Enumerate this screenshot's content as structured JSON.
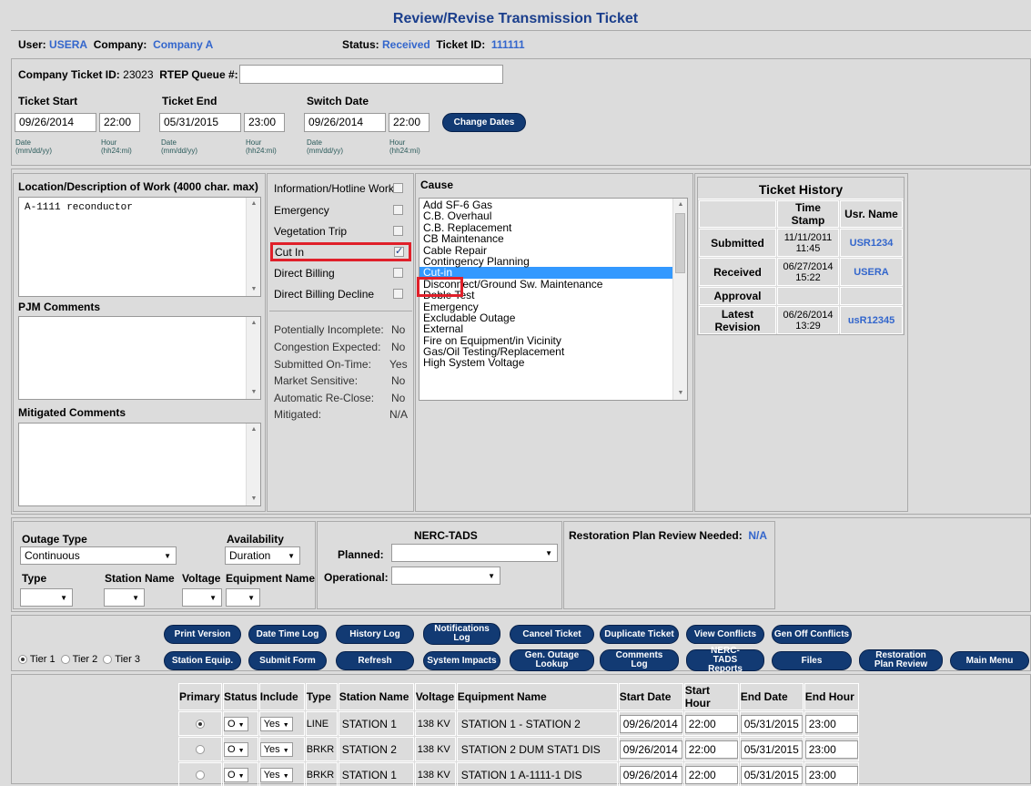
{
  "header": {
    "title": "Review/Revise Transmission Ticket"
  },
  "userbar": {
    "user_label": "User:",
    "user": "USERA",
    "company_label": "Company:",
    "company": "Company A",
    "status_label": "Status:",
    "status": "Received",
    "ticket_label": "Ticket ID:",
    "ticket_id": "111111"
  },
  "ticket": {
    "company_ticket_label": "Company Ticket ID:",
    "company_ticket_id": "23023",
    "rtep_label": "RTEP Queue #:",
    "rtep_value": ""
  },
  "dates": {
    "start_label": "Ticket Start",
    "end_label": "Ticket End",
    "switch_label": "Switch Date",
    "start_date": "09/26/2014",
    "start_hour": "22:00",
    "end_date": "05/31/2015",
    "end_hour": "23:00",
    "switch_date": "09/26/2014",
    "switch_hour": "22:00",
    "change_button": "Change Dates",
    "hint_date": "Date",
    "hint_date_fmt": "(mm/dd/yy)",
    "hint_hour": "Hour",
    "hint_hour_fmt": "(hh24:mi)"
  },
  "location": {
    "label": "Location/Description of Work (4000 char. max)",
    "value": "A-1111  reconductor"
  },
  "pjm": {
    "label": "PJM Comments"
  },
  "mitigated": {
    "label": "Mitigated Comments"
  },
  "flags": [
    {
      "label": "Information/Hotline Work",
      "checked": false
    },
    {
      "label": "Emergency",
      "checked": false
    },
    {
      "label": "Vegetation Trip",
      "checked": false
    },
    {
      "label": "Cut In",
      "checked": true
    },
    {
      "label": "Direct Billing",
      "checked": false
    },
    {
      "label": "Direct Billing Decline",
      "checked": false
    }
  ],
  "status_rows": [
    {
      "label": "Potentially Incomplete:",
      "value": "No"
    },
    {
      "label": "Congestion Expected:",
      "value": "No"
    },
    {
      "label": "Submitted On-Time:",
      "value": "Yes"
    },
    {
      "label": "Market Sensitive:",
      "value": "No"
    },
    {
      "label": "Automatic Re-Close:",
      "value": "No"
    },
    {
      "label": "Mitigated:",
      "value": "N/A"
    }
  ],
  "cause": {
    "label": "Cause",
    "selected": "Cut-in",
    "items": [
      "Add SF-6 Gas",
      "C.B. Overhaul",
      "C.B. Replacement",
      "CB Maintenance",
      "Cable Repair",
      "Contingency Planning",
      "Cut-in",
      "Disconnect/Ground Sw. Maintenance",
      "Doble Test",
      "Emergency",
      "Excludable Outage",
      "External",
      "Fire on Equipment/in Vicinity",
      "Gas/Oil Testing/Replacement",
      "High System Voltage"
    ]
  },
  "history": {
    "title": "Ticket History",
    "col_time": "Time Stamp",
    "col_user": "Usr. Name",
    "rows": [
      {
        "label": "Submitted",
        "date": "11/11/2011",
        "time": "11:45",
        "user": "USR1234"
      },
      {
        "label": "Received",
        "date": "06/27/2014",
        "time": "15:22",
        "user": "USERA"
      },
      {
        "label": "Approval",
        "date": "",
        "time": "",
        "user": ""
      },
      {
        "label": "Latest Revision",
        "date": "06/26/2014",
        "time": "13:29",
        "user": "usR12345"
      }
    ]
  },
  "outage": {
    "type_label": "Outage Type",
    "type_value": "Continuous",
    "availability_label": "Availability",
    "availability_value": "Duration",
    "type2_label": "Type",
    "station_label": "Station Name",
    "voltage_label": "Voltage",
    "equipment_label": "Equipment Name"
  },
  "nerc": {
    "title": "NERC-TADS",
    "planned_label": "Planned:",
    "operational_label": "Operational:"
  },
  "restoration": {
    "label": "Restoration Plan Review Needed:",
    "value": "N/A"
  },
  "buttons": {
    "print": "Print Version",
    "datetime": "Date Time Log",
    "history": "History Log",
    "notifications": "Notifications Log",
    "cancel": "Cancel Ticket",
    "duplicate": "Duplicate Ticket",
    "conflicts": "View Conflicts",
    "genoff": "Gen Off Conflicts",
    "station_equip": "Station Equip.",
    "submit": "Submit Form",
    "refresh": "Refresh",
    "impacts": "System Impacts",
    "genoutage": "Gen. Outage Lookup",
    "comments": "Comments Log",
    "nerc_reports": "NERC-TADS Reports",
    "files": "Files",
    "restoration": "Restoration Plan Review",
    "mainmenu": "Main Menu"
  },
  "tiers": [
    "Tier 1",
    "Tier 2",
    "Tier 3"
  ],
  "equipment": {
    "headers": [
      "Primary",
      "Status",
      "Include",
      "Type",
      "Station Name",
      "Voltage",
      "Equipment Name",
      "Start Date",
      "Start Hour",
      "End Date",
      "End Hour"
    ],
    "rows": [
      {
        "status": "O",
        "include": "Yes",
        "type": "LINE",
        "station": "STATION 1",
        "voltage": "138 KV",
        "equipment": "STATION 1 - STATION 2",
        "start_date": "09/26/2014",
        "start_hour": "22:00",
        "end_date": "05/31/2015",
        "end_hour": "23:00"
      },
      {
        "status": "O",
        "include": "Yes",
        "type": "BRKR",
        "station": "STATION 2",
        "voltage": "138 KV",
        "equipment": "STATION 2 DUM STAT1 DIS",
        "start_date": "09/26/2014",
        "start_hour": "22:00",
        "end_date": "05/31/2015",
        "end_hour": "23:00"
      },
      {
        "status": "O",
        "include": "Yes",
        "type": "BRKR",
        "station": "STATION 1",
        "voltage": "138 KV",
        "equipment": "STATION 1 A-1111-1 DIS",
        "start_date": "09/26/2014",
        "start_hour": "22:00",
        "end_date": "05/31/2015",
        "end_hour": "23:00"
      }
    ]
  }
}
